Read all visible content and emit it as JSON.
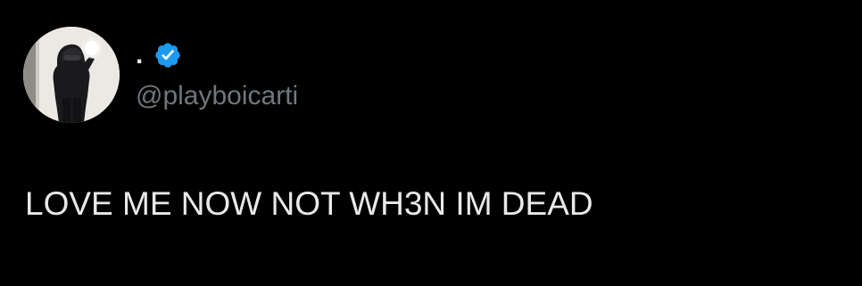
{
  "tweet": {
    "author": {
      "display_name": ".",
      "handle": "@playboicarti",
      "verified": true,
      "avatar_icon": "profile-photo"
    },
    "text": "LOVE ME NOW NOT WH3N IM DEAD"
  },
  "colors": {
    "background": "#000000",
    "primary_text": "#e7e9ea",
    "secondary_text": "#71767b",
    "verified_badge": "#1d9bf0"
  }
}
